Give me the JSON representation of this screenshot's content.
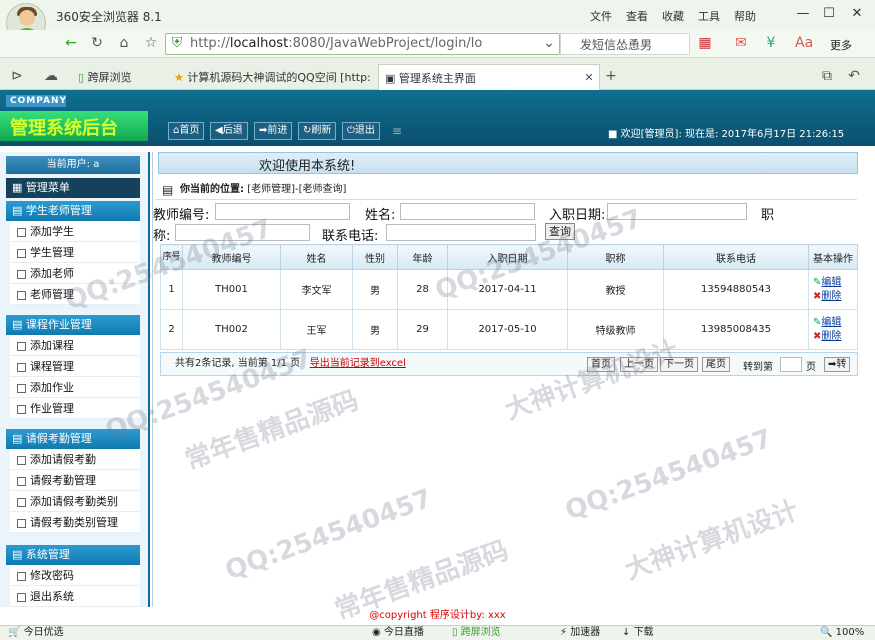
{
  "browser": {
    "title": "360安全浏览器 8.1",
    "menus": [
      "文件",
      "查看",
      "收藏",
      "工具",
      "帮助"
    ],
    "url_host": "localhost",
    "url_rest": ":8080/JavaWebProject/login/lo",
    "url_scheme": "http://",
    "search_text": "发短信怂恿男",
    "more": "更多",
    "tabs": [
      "跨屏浏览",
      "计算机源码大神调试的QQ空间 [http:",
      "管理系统主界面"
    ]
  },
  "header": {
    "company": "COMPANY",
    "app_name": "管理系统后台",
    "buttons": [
      "首页",
      "后退",
      "前进",
      "刷新",
      "退出"
    ],
    "welcome": "欢迎[管理员]:  现在是: 2017年6月17日  21:26:15"
  },
  "sidebar": {
    "current_user": "当前用户: a",
    "menu_title": "管理菜单",
    "sections": [
      {
        "title": "学生老师管理",
        "items": [
          "添加学生",
          "学生管理",
          "添加老师",
          "老师管理"
        ]
      },
      {
        "title": "课程作业管理",
        "items": [
          "添加课程",
          "课程管理",
          "添加作业",
          "作业管理"
        ]
      },
      {
        "title": "请假考勤管理",
        "items": [
          "添加请假考勤",
          "请假考勤管理",
          "添加请假考勤类别",
          "请假考勤类别管理"
        ]
      },
      {
        "title": "系统管理",
        "items": [
          "修改密码",
          "退出系统"
        ]
      }
    ]
  },
  "main": {
    "welcome": "欢迎使用本系统!",
    "position_label": "你当前的位置:",
    "position": "[老师管理]-[老师查询]",
    "search": {
      "teacher_no": "教师编号:",
      "name": "姓名:",
      "hire_date": "入职日期:",
      "title_1": "职",
      "title_2": "称:",
      "phone": "联系电话:",
      "query": "查询"
    },
    "table": {
      "headers": [
        "序号",
        "教师编号",
        "姓名",
        "性别",
        "年龄",
        "入职日期",
        "职称",
        "联系电话",
        "基本操作"
      ],
      "rows": [
        [
          "1",
          "TH001",
          "李文军",
          "男",
          "28",
          "2017-04-11",
          "教授",
          "13594880543"
        ],
        [
          "2",
          "TH002",
          "王军",
          "男",
          "29",
          "2017-05-10",
          "特级教师",
          "13985008435"
        ]
      ],
      "edit": "编辑",
      "delete": "删除"
    },
    "pager": {
      "summary": "共有2条记录, 当前第 1/1 页",
      "export": "导出当前记录到excel",
      "first": "首页",
      "prev": "上一页",
      "next": "下一页",
      "last": "尾页",
      "goto": "转到第",
      "page": "页",
      "go": "转"
    }
  },
  "footer": "@copyright 程序设计by: xxx",
  "statusbar": {
    "left": "今日优选",
    "live": "今日直播",
    "cross": "跨屏浏览",
    "accel": "加速器",
    "download": "下载",
    "zoom": "100%"
  },
  "watermarks": [
    "QQ:254540457",
    "大神计算机设计",
    "常年售精品源码"
  ]
}
